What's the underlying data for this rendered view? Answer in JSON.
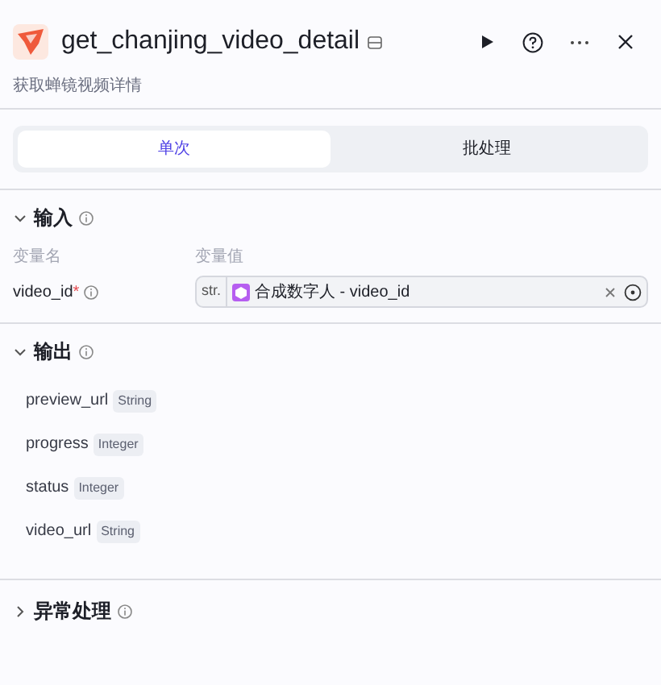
{
  "node": {
    "title": "get_chanjing_video_detail",
    "description": "获取蝉镜视频详情"
  },
  "tabs": [
    {
      "label": "单次",
      "selected": true
    },
    {
      "label": "批处理",
      "selected": false
    }
  ],
  "sections": [
    {
      "kind": "input",
      "title": "输入",
      "expanded": true,
      "columns": [
        "变量名",
        "变量值"
      ],
      "rows": [
        {
          "name": "video_id",
          "required_mark": "*",
          "type": "str.",
          "value": "合成数字人 - video_id"
        }
      ]
    },
    {
      "kind": "output",
      "title": "输出",
      "expanded": true,
      "fields": [
        {
          "name": "preview_url",
          "type": "String"
        },
        {
          "name": "progress",
          "type": "Integer"
        },
        {
          "name": "status",
          "type": "Integer"
        },
        {
          "name": "video_url",
          "type": "String"
        }
      ]
    },
    {
      "kind": "exception",
      "title": "异常处理",
      "expanded": false
    }
  ]
}
